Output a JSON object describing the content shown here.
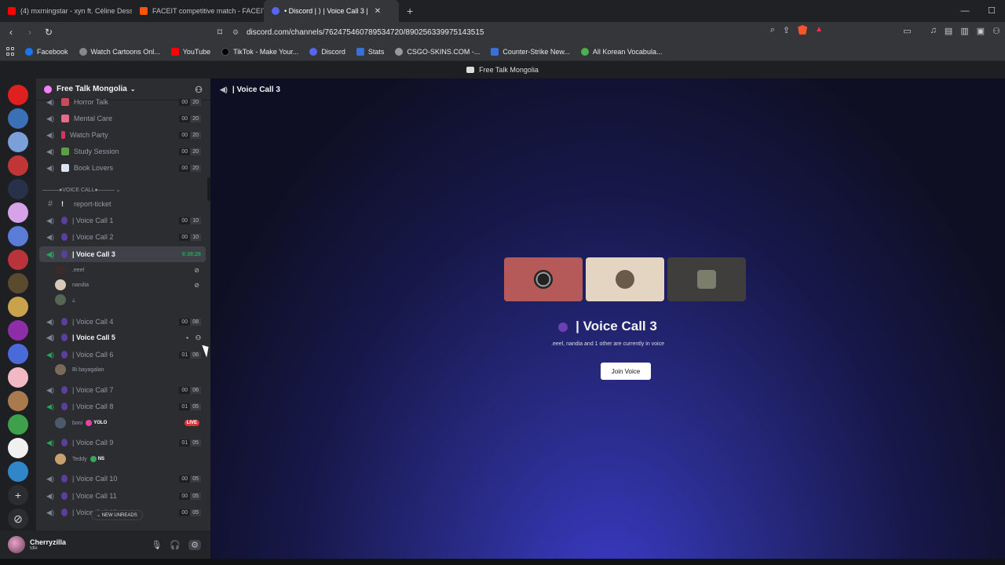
{
  "browser": {
    "tabs": [
      {
        "title": "(4) mxrningstar - xyn ft. Céline Dessb...",
        "color": "#ff0000"
      },
      {
        "title": "FACEIT competitive match - FACEIT.c...",
        "color": "#ff5500"
      },
      {
        "title": "• Discord | ⟩ | Voice Call 3 |",
        "color": "#5865f2"
      }
    ],
    "url": "discord.com/channels/762475460789534720/890256339975143515",
    "bookmarks": [
      {
        "label": "Facebook",
        "color": "#1877f2"
      },
      {
        "label": "Watch Cartoons Onl...",
        "color": "#888888"
      },
      {
        "label": "YouTube",
        "color": "#ff0000"
      },
      {
        "label": "TikTok - Make Your...",
        "color": "#000000"
      },
      {
        "label": "Discord",
        "color": "#5865f2"
      },
      {
        "label": "Stats",
        "color": "#3a6fd8"
      },
      {
        "label": "CSGO-SKINS.COM -...",
        "color": "#999999"
      },
      {
        "label": "Counter-Strike New...",
        "color": "#3a6fd8"
      },
      {
        "label": "All Korean Vocabula...",
        "color": "#4caf50"
      }
    ]
  },
  "discord": {
    "window_title": "Free Talk Mongolia",
    "server_name": "Free Talk Mongolia",
    "channels_top": [
      {
        "name": "Horror Talk",
        "count": [
          "00",
          "20"
        ]
      },
      {
        "name": "Mental Care",
        "count": [
          "00",
          "20"
        ]
      },
      {
        "name": "Watch Party",
        "count": [
          "00",
          "20"
        ]
      },
      {
        "name": "Study Session",
        "count": [
          "00",
          "20"
        ]
      },
      {
        "name": "Book Lovers",
        "count": [
          "00",
          "20"
        ]
      }
    ],
    "category": "———●VOICE CALL●——— ⌄",
    "report": "report-ticket",
    "voice_calls": [
      {
        "name": "| Voice Call 1",
        "count": [
          "00",
          "10"
        ]
      },
      {
        "name": "| Voice Call 2",
        "count": [
          "00",
          "10"
        ]
      },
      {
        "name": "| Voice Call 3",
        "time": "6:38:26"
      },
      {
        "name": "| Voice Call 4",
        "count": [
          "00",
          "08"
        ]
      },
      {
        "name": "| Voice Call 5"
      },
      {
        "name": "| Voice Call 6",
        "count": [
          "01",
          "06"
        ]
      },
      {
        "name": "| Voice Call 7",
        "count": [
          "00",
          "06"
        ]
      },
      {
        "name": "| Voice Call 8",
        "count": [
          "01",
          "05"
        ]
      },
      {
        "name": "| Voice Call 9",
        "count": [
          "01",
          "05"
        ]
      },
      {
        "name": "| Voice Call 10",
        "count": [
          "00",
          "05"
        ]
      },
      {
        "name": "| Voice Call 11",
        "count": [
          "00",
          "05"
        ]
      },
      {
        "name": "| Voice Call 12",
        "count": [
          "00",
          "05"
        ]
      }
    ],
    "members_vc3": [
      ".eeel",
      "nandia",
      "¿"
    ],
    "member_vc6": "Bi bayagalan",
    "member_vc8": "boni",
    "member_vc8_tag": "YOLO",
    "live": "LIVE",
    "member_vc9": "Teddy",
    "member_vc9_tag": "NS",
    "new_unreads": "⌄ NEW UNREADS",
    "user": {
      "name": "Cherryzilla",
      "status": "Idle"
    },
    "main": {
      "header": "| Voice Call 3",
      "title": "| Voice Call 3",
      "subtitle": ".eeel, nandia and 1 other are currently in voice",
      "join_label": "Join Voice"
    }
  }
}
